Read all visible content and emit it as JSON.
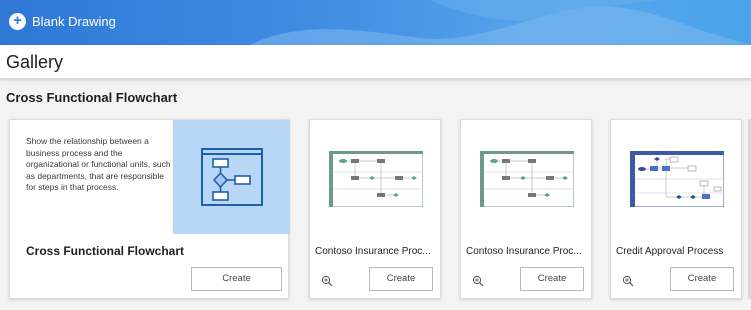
{
  "header": {
    "new_label": "Blank Drawing",
    "new_icon": "plus-circle-icon",
    "colors": {
      "accent": "#2f78d6",
      "banner_light": "#58a6ec"
    }
  },
  "gallery": {
    "title": "Gallery",
    "section_title": "Cross Functional Flowchart"
  },
  "featured": {
    "name": "Cross Functional Flowchart",
    "description": "Show the relationship between a business process and the organizational or functional units, such as departments, that are responsible for steps in that process.",
    "create_label": "Create",
    "thumb_color": "#b8d6f6"
  },
  "templates": [
    {
      "name": "Contoso Insurance Proc...",
      "create_label": "Create",
      "zoom_icon": "zoom-in-icon"
    },
    {
      "name": "Contoso Insurance Proc...",
      "create_label": "Create",
      "zoom_icon": "zoom-in-icon"
    },
    {
      "name": "Credit Approval Process",
      "create_label": "Create",
      "zoom_icon": "zoom-in-icon"
    }
  ]
}
